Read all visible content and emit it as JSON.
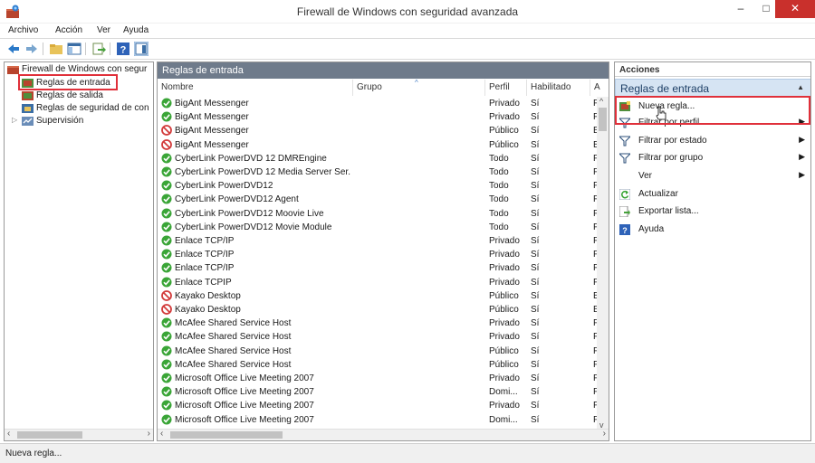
{
  "window": {
    "title": "Firewall de Windows con seguridad avanzada",
    "minimize": "–",
    "maximize": "□",
    "close": "✕"
  },
  "menu": [
    "Archivo",
    "Acción",
    "Ver",
    "Ayuda"
  ],
  "tree": {
    "root": "Firewall de Windows con segur",
    "items": [
      "Reglas de entrada",
      "Reglas de salida",
      "Reglas de seguridad de con",
      "Supervisión"
    ]
  },
  "center": {
    "title": "Reglas de entrada",
    "columns": [
      "Nombre",
      "Grupo",
      "Perfil",
      "Habilitado",
      "A"
    ],
    "rows": [
      {
        "name": "BigAnt Messenger",
        "profile": "Privado",
        "enabled": "Sí",
        "action": "P",
        "status": "allow"
      },
      {
        "name": "BigAnt Messenger",
        "profile": "Privado",
        "enabled": "Sí",
        "action": "P",
        "status": "allow"
      },
      {
        "name": "BigAnt Messenger",
        "profile": "Público",
        "enabled": "Sí",
        "action": "B",
        "status": "block"
      },
      {
        "name": "BigAnt Messenger",
        "profile": "Público",
        "enabled": "Sí",
        "action": "B",
        "status": "block"
      },
      {
        "name": "CyberLink PowerDVD 12 DMREngine",
        "profile": "Todo",
        "enabled": "Sí",
        "action": "P",
        "status": "allow"
      },
      {
        "name": "CyberLink PowerDVD 12 Media Server Ser...",
        "profile": "Todo",
        "enabled": "Sí",
        "action": "P",
        "status": "allow"
      },
      {
        "name": "CyberLink PowerDVD12",
        "profile": "Todo",
        "enabled": "Sí",
        "action": "P",
        "status": "allow"
      },
      {
        "name": "CyberLink PowerDVD12 Agent",
        "profile": "Todo",
        "enabled": "Sí",
        "action": "P",
        "status": "allow"
      },
      {
        "name": "CyberLink PowerDVD12 Moovie Live",
        "profile": "Todo",
        "enabled": "Sí",
        "action": "P",
        "status": "allow"
      },
      {
        "name": "CyberLink PowerDVD12 Movie Module",
        "profile": "Todo",
        "enabled": "Sí",
        "action": "P",
        "status": "allow"
      },
      {
        "name": "Enlace TCP/IP",
        "profile": "Privado",
        "enabled": "Sí",
        "action": "P",
        "status": "allow"
      },
      {
        "name": "Enlace TCP/IP",
        "profile": "Privado",
        "enabled": "Sí",
        "action": "P",
        "status": "allow"
      },
      {
        "name": "Enlace TCP/IP",
        "profile": "Privado",
        "enabled": "Sí",
        "action": "P",
        "status": "allow"
      },
      {
        "name": "Enlace TCPIP",
        "profile": "Privado",
        "enabled": "Sí",
        "action": "P",
        "status": "allow"
      },
      {
        "name": "Kayako Desktop",
        "profile": "Público",
        "enabled": "Sí",
        "action": "B",
        "status": "block"
      },
      {
        "name": "Kayako Desktop",
        "profile": "Público",
        "enabled": "Sí",
        "action": "B",
        "status": "block"
      },
      {
        "name": "McAfee Shared Service Host",
        "profile": "Privado",
        "enabled": "Sí",
        "action": "P",
        "status": "allow"
      },
      {
        "name": "McAfee Shared Service Host",
        "profile": "Privado",
        "enabled": "Sí",
        "action": "P",
        "status": "allow"
      },
      {
        "name": "McAfee Shared Service Host",
        "profile": "Público",
        "enabled": "Sí",
        "action": "P",
        "status": "allow"
      },
      {
        "name": "McAfee Shared Service Host",
        "profile": "Público",
        "enabled": "Sí",
        "action": "P",
        "status": "allow"
      },
      {
        "name": "Microsoft Office Live Meeting 2007",
        "profile": "Privado",
        "enabled": "Sí",
        "action": "P",
        "status": "allow"
      },
      {
        "name": "Microsoft Office Live Meeting 2007",
        "profile": "Domi...",
        "enabled": "Sí",
        "action": "P",
        "status": "allow"
      },
      {
        "name": "Microsoft Office Live Meeting 2007",
        "profile": "Privado",
        "enabled": "Sí",
        "action": "P",
        "status": "allow"
      },
      {
        "name": "Microsoft Office Live Meeting 2007",
        "profile": "Domi...",
        "enabled": "Sí",
        "action": "P",
        "status": "allow"
      }
    ]
  },
  "actions": {
    "title": "Acciones",
    "section": "Reglas de entrada",
    "items": [
      {
        "label": "Nueva regla...",
        "icon": "new-rule-icon",
        "arrow": ""
      },
      {
        "label": "Filtrar por perfil",
        "icon": "filter-icon",
        "arrow": "▶"
      },
      {
        "label": "Filtrar por estado",
        "icon": "filter-icon",
        "arrow": "▶"
      },
      {
        "label": "Filtrar por grupo",
        "icon": "filter-icon",
        "arrow": "▶"
      },
      {
        "label": "Ver",
        "icon": "",
        "arrow": "▶"
      },
      {
        "label": "Actualizar",
        "icon": "refresh-icon",
        "arrow": ""
      },
      {
        "label": "Exportar lista...",
        "icon": "export-icon",
        "arrow": ""
      },
      {
        "label": "Ayuda",
        "icon": "help-icon",
        "arrow": ""
      }
    ]
  },
  "status": "Nueva regla...",
  "colors": {
    "allow": "#3aa537",
    "block": "#d23b3b",
    "highlight": "#e0303a",
    "pane_header": "#6f7b8b"
  }
}
